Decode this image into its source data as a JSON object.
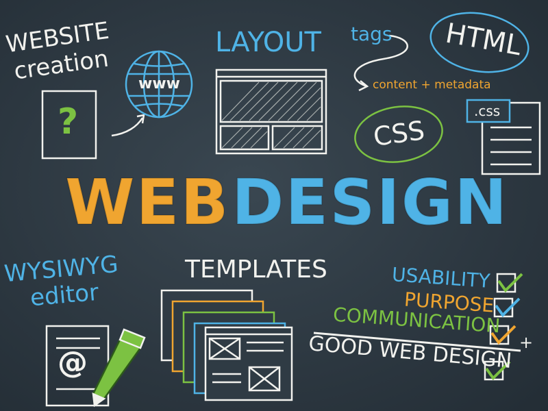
{
  "website_creation": {
    "line1": "WEBSITE",
    "line2": "creation"
  },
  "question_mark": "?",
  "globe_label": "www",
  "layout_title": "LAYOUT",
  "tags": {
    "label": "tags",
    "note": "content + metadata"
  },
  "html_bubble": "HTML",
  "css_bubble": "CSS",
  "css_file_tab": ".css",
  "headline": {
    "web": "WEB",
    "design": "DESIGN"
  },
  "wysiwyg": {
    "line1": "WYSIWYG",
    "line2": "editor"
  },
  "at_symbol": "@",
  "templates_title": "TEMPLATES",
  "checklist": [
    {
      "label": "USABILITY",
      "color": "#4fb3e6"
    },
    {
      "label": "PURPOSE",
      "color": "#f0a530"
    },
    {
      "label": "COMMUNICATION",
      "color": "#7cc242"
    }
  ],
  "checklist_sum": "+",
  "result": "GOOD WEB DESIGN",
  "colors": {
    "board": "#2f3b44",
    "white": "#f2f2ee",
    "blue": "#4fb3e6",
    "orange": "#f0a530",
    "green": "#7cc242"
  }
}
